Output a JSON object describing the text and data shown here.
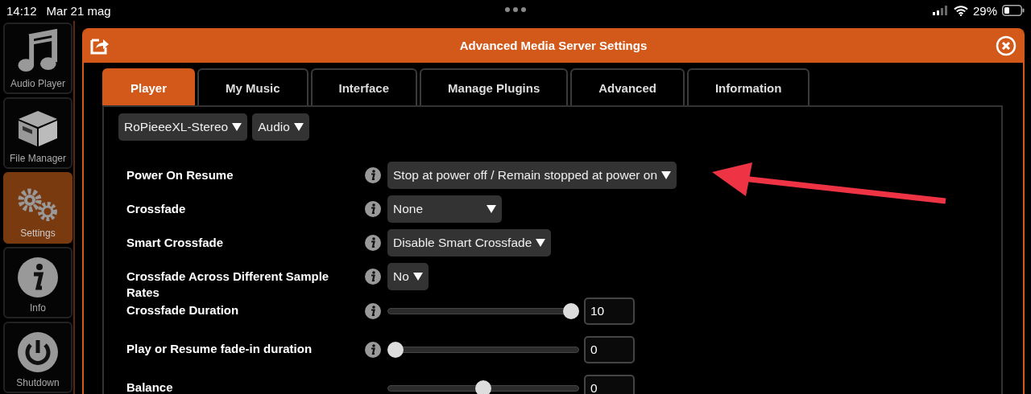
{
  "status_bar": {
    "time": "14:12",
    "date": "Mar 21 mag",
    "battery": "29%"
  },
  "sidebar": {
    "items": [
      {
        "kind": "music",
        "label": "Audio Player",
        "selected": false
      },
      {
        "kind": "box",
        "label": "File Manager",
        "selected": false
      },
      {
        "kind": "gears",
        "label": "Settings",
        "selected": true
      },
      {
        "kind": "info",
        "label": "Info",
        "selected": false
      },
      {
        "kind": "power",
        "label": "Shutdown",
        "selected": false
      }
    ]
  },
  "window": {
    "title": "Advanced Media Server Settings"
  },
  "tabs": [
    {
      "label": "Player",
      "selected": true
    },
    {
      "label": "My Music",
      "selected": false
    },
    {
      "label": "Interface",
      "selected": false
    },
    {
      "label": "Manage Plugins",
      "selected": false
    },
    {
      "label": "Advanced",
      "selected": false
    },
    {
      "label": "Information",
      "selected": false
    }
  ],
  "selectors": [
    {
      "value": "RoPieeeXL-Stereo"
    },
    {
      "value": "Audio"
    }
  ],
  "settings": [
    {
      "kind": "select",
      "label": "Power On Resume",
      "value": "Stop at power off / Remain stopped at power on"
    },
    {
      "kind": "select",
      "label": "Crossfade",
      "value": "None"
    },
    {
      "kind": "select",
      "label": "Smart Crossfade",
      "value": "Disable Smart Crossfade"
    },
    {
      "kind": "select",
      "label": "Crossfade Across Different Sample Rates",
      "value": "No"
    },
    {
      "kind": "slider",
      "label": "Crossfade Duration",
      "level": 1,
      "value": "10"
    },
    {
      "kind": "slider",
      "label": "Play or Resume fade-in duration",
      "level": 0,
      "value": "0"
    },
    {
      "kind": "slider",
      "label": "Balance",
      "level": 0.5,
      "value": "0"
    }
  ]
}
